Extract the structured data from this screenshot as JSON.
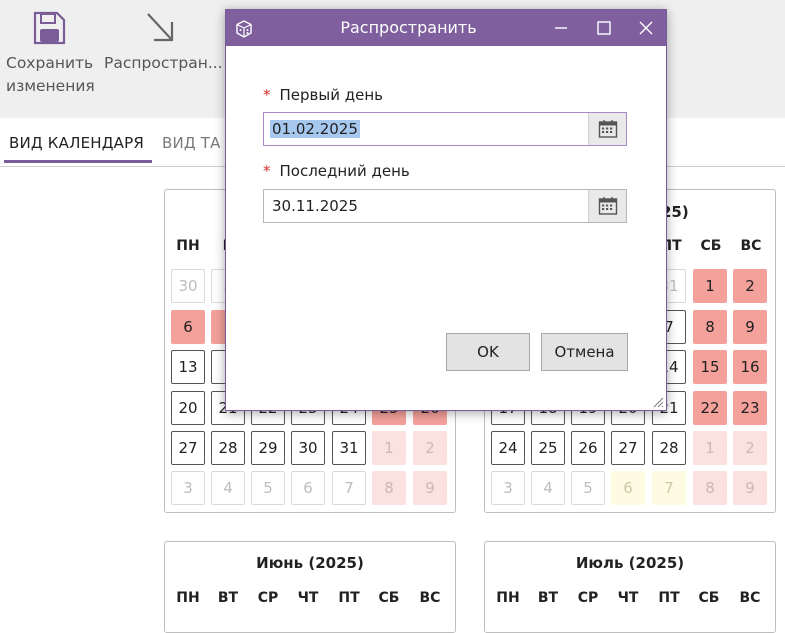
{
  "toolbar": {
    "save_label_line1": "Сохранить",
    "save_label_line2": "изменения",
    "distribute_label": "Распростран...",
    "save_icon": "floppy-disk-icon",
    "distribute_icon": "arrow-down-right-icon"
  },
  "tabs": {
    "calendar_view": "ВИД КАЛЕНДАРЯ",
    "table_view_partial": "ВИД ТА"
  },
  "weekdays": [
    "ПН",
    "ВТ",
    "СР",
    "ЧТ",
    "ПТ",
    "СБ",
    "ВС"
  ],
  "months": {
    "left_top": {
      "visible_weekdays": [
        "ПН",
        "В"
      ],
      "rows": [
        [
          "30",
          "3"
        ],
        [
          "6",
          ""
        ],
        [
          "13",
          "1"
        ],
        [
          "20",
          "21",
          "22",
          "23",
          "24",
          "25",
          "26"
        ],
        [
          "27",
          "28",
          "29",
          "30",
          "31",
          "1",
          "2"
        ],
        [
          "3",
          "4",
          "5",
          "6",
          "7",
          "8",
          "9"
        ]
      ]
    },
    "right_top": {
      "title_partial": "25)",
      "visible_weekdays": [
        "ПТ",
        "СБ",
        "ВС"
      ],
      "rows": [
        [
          "31",
          "1",
          "2"
        ],
        [
          "7",
          "8",
          "9"
        ],
        [
          "14",
          "15",
          "16"
        ],
        [
          "17",
          "18",
          "19",
          "20",
          "21",
          "22",
          "23"
        ],
        [
          "24",
          "25",
          "26",
          "27",
          "28",
          "1",
          "2"
        ],
        [
          "3",
          "4",
          "5",
          "6",
          "7",
          "8",
          "9"
        ]
      ]
    },
    "june": {
      "title": "Июнь (2025)"
    },
    "july": {
      "title": "Июль (2025)"
    }
  },
  "dialog": {
    "title": "Распространить",
    "first_day_label": "Первый день",
    "first_day_value": "01.02.2025",
    "last_day_label": "Последний день",
    "last_day_value": "30.11.2025",
    "required_marker": "*",
    "ok_label": "OK",
    "cancel_label": "Отмена",
    "minimize_symbol": "—",
    "close_symbol": "✕"
  },
  "colors": {
    "accent": "#7f5f9e",
    "holiday": "#f4a09b",
    "holiday_other_month": "#fbe2e0",
    "preholiday_other_month": "#fdfbe1",
    "selection": "#a6c8ef"
  }
}
